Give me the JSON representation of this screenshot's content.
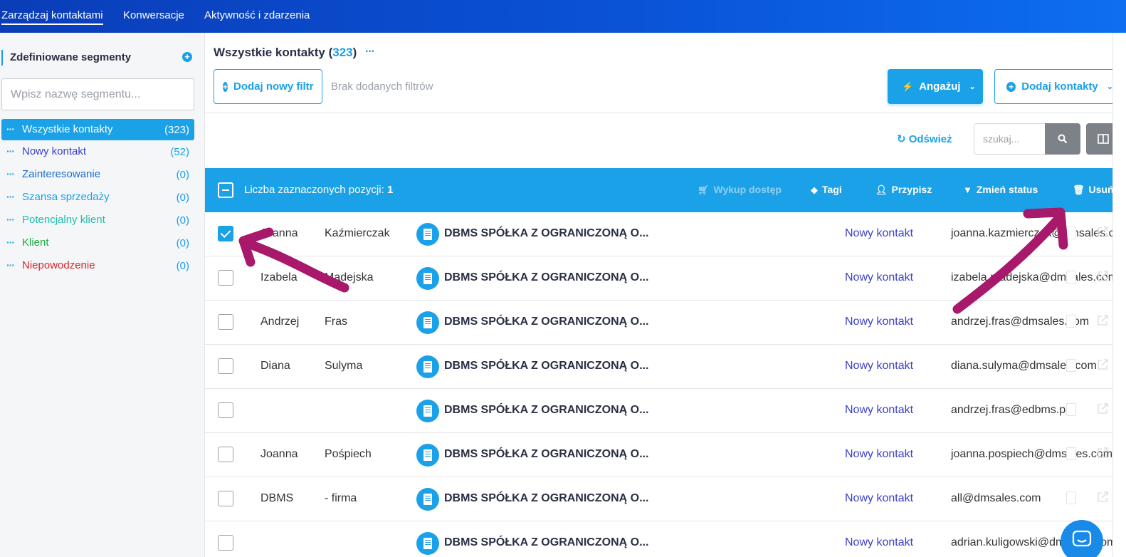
{
  "topnav": {
    "tabs": [
      {
        "label": "Zarządzaj kontaktami",
        "active": true
      },
      {
        "label": "Konwersacje",
        "active": false
      },
      {
        "label": "Aktywność i zdarzenia",
        "active": false
      }
    ]
  },
  "sidebar": {
    "title": "Zdefiniowane segmenty",
    "search_placeholder": "Wpisz nazwę segmentu...",
    "items": [
      {
        "label": "Wszystkie kontakty",
        "count": "(323)",
        "color": "#ffffff",
        "active": true
      },
      {
        "label": "Nowy kontakt",
        "count": "(52)",
        "color": "#3b3fc9"
      },
      {
        "label": "Zainteresowanie",
        "count": "(0)",
        "color": "#1a6fd1"
      },
      {
        "label": "Szansa sprzedaży",
        "count": "(0)",
        "color": "#1aa1e8"
      },
      {
        "label": "Potencjalny klient",
        "count": "(0)",
        "color": "#1fbfae"
      },
      {
        "label": "Klient",
        "count": "(0)",
        "color": "#1fa944"
      },
      {
        "label": "Niepowodzenie",
        "count": "(0)",
        "color": "#d7262b"
      }
    ]
  },
  "main": {
    "title": "Wszystkie kontakty",
    "title_count": "323",
    "add_filter": "Dodaj nowy filtr",
    "no_filters": "Brak dodanych filtrów",
    "engage": "Angażuj",
    "add_contacts": "Dodaj kontakty",
    "refresh": "Odśwież",
    "search_placeholder": "szukaj..."
  },
  "bulkbar": {
    "label": "Liczba zaznaczonych pozycji:",
    "count": "1",
    "actions": {
      "buy": "Wykup dostęp",
      "tags": "Tagi",
      "assign": "Przypisz",
      "status": "Zmień status",
      "delete": "Usuń"
    }
  },
  "contacts": [
    {
      "first": "Joanna",
      "last": "Kaźmierczak",
      "company": "DBMS SPÓŁKA Z OGRANICZONĄ O...",
      "status": "Nowy kontakt",
      "email": "joanna.kazmierczak@dmsales.com",
      "checked": true
    },
    {
      "first": "Izabela",
      "last": "Madejska",
      "company": "DBMS SPÓŁKA Z OGRANICZONĄ O...",
      "status": "Nowy kontakt",
      "email": "izabela.madejska@dmsales.com",
      "checked": false
    },
    {
      "first": "Andrzej",
      "last": "Fras",
      "company": "DBMS SPÓŁKA Z OGRANICZONĄ O...",
      "status": "Nowy kontakt",
      "email": "andrzej.fras@dmsales.com",
      "checked": false
    },
    {
      "first": "Diana",
      "last": "Sulyma",
      "company": "DBMS SPÓŁKA Z OGRANICZONĄ O...",
      "status": "Nowy kontakt",
      "email": "diana.sulyma@dmsales.com",
      "checked": false
    },
    {
      "first": "",
      "last": "",
      "company": "DBMS SPÓŁKA Z OGRANICZONĄ O...",
      "status": "Nowy kontakt",
      "email": "andrzej.fras@edbms.pl",
      "checked": false
    },
    {
      "first": "Joanna",
      "last": "Pośpiech",
      "company": "DBMS SPÓŁKA Z OGRANICZONĄ O...",
      "status": "Nowy kontakt",
      "email": "joanna.pospiech@dmsales.com",
      "checked": false
    },
    {
      "first": "DBMS",
      "last": "- firma",
      "company": "DBMS SPÓŁKA Z OGRANICZONĄ O...",
      "status": "Nowy kontakt",
      "email": "all@dmsales.com",
      "checked": false
    },
    {
      "first": "",
      "last": "",
      "company": "DBMS SPÓŁKA Z OGRANICZONĄ O...",
      "status": "Nowy kontakt",
      "email": "adrian.kuligowski@dmsales.com",
      "checked": false
    }
  ],
  "colors": {
    "accent": "#1aa1e8",
    "nav_from": "#0a3db8",
    "nav_to": "#0d6ef0",
    "status_text": "#3b3fc9",
    "annotation_arrow": "#a8186b"
  }
}
